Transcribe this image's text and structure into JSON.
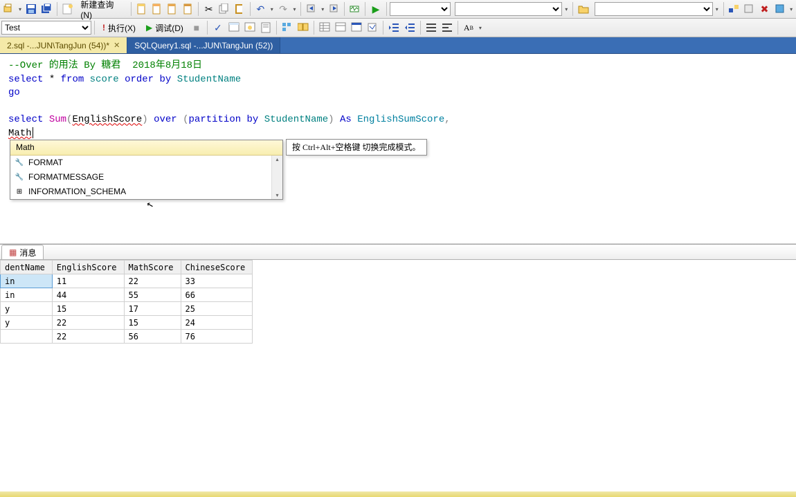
{
  "toolbar1": {
    "new_query": "新建查询(N)",
    "combo1_value": "",
    "combo2_value": ""
  },
  "toolbar2": {
    "db_combo": "Test",
    "execute": "执行(X)",
    "debug": "调试(D)"
  },
  "tabs": {
    "active": "2.sql -...JUN\\TangJun (54))*",
    "inactive": "SQLQuery1.sql -...JUN\\TangJun (52))"
  },
  "editor": {
    "comment": "--Over 的用法 By 糖君  2018年8月18日",
    "l2_select": "select",
    "l2_star": " * ",
    "l2_from": "from",
    "l2_sp": " ",
    "l2_score": "score",
    "l2_sp2": " ",
    "l2_orderby": "order by",
    "l2_sp3": " ",
    "l2_student": "StudentName",
    "l3_go": "go",
    "l5_select": "select",
    "l5_sp1": " ",
    "l5_sum": "Sum",
    "l5_open": "(",
    "l5_eng": "EnglishScore",
    "l5_close": ")",
    "l5_sp2": " ",
    "l5_over": "over",
    "l5_sp3": " ",
    "l5_open2": "(",
    "l5_part": "partition by",
    "l5_sp4": " ",
    "l5_student": "StudentName",
    "l5_close2": ")",
    "l5_sp5": " ",
    "l5_as": "As",
    "l5_sp6": " ",
    "l5_alias": "EnglishSumScore",
    "l5_comma": ",",
    "l6_math": "Math"
  },
  "intellisense": {
    "typed": "Math",
    "items": [
      "FORMAT",
      "FORMATMESSAGE",
      "INFORMATION_SCHEMA"
    ],
    "tooltip": "按 Ctrl+Alt+空格键 切换完成模式。"
  },
  "results": {
    "tab_label": "消息",
    "headers": [
      "dentName",
      "EnglishScore",
      "MathScore",
      "ChineseScore"
    ],
    "rows": [
      [
        "in",
        "11",
        "22",
        "33"
      ],
      [
        "in",
        "44",
        "55",
        "66"
      ],
      [
        "y",
        "15",
        "17",
        "25"
      ],
      [
        "y",
        "22",
        "15",
        "24"
      ],
      [
        "",
        "22",
        "56",
        "76"
      ]
    ]
  }
}
